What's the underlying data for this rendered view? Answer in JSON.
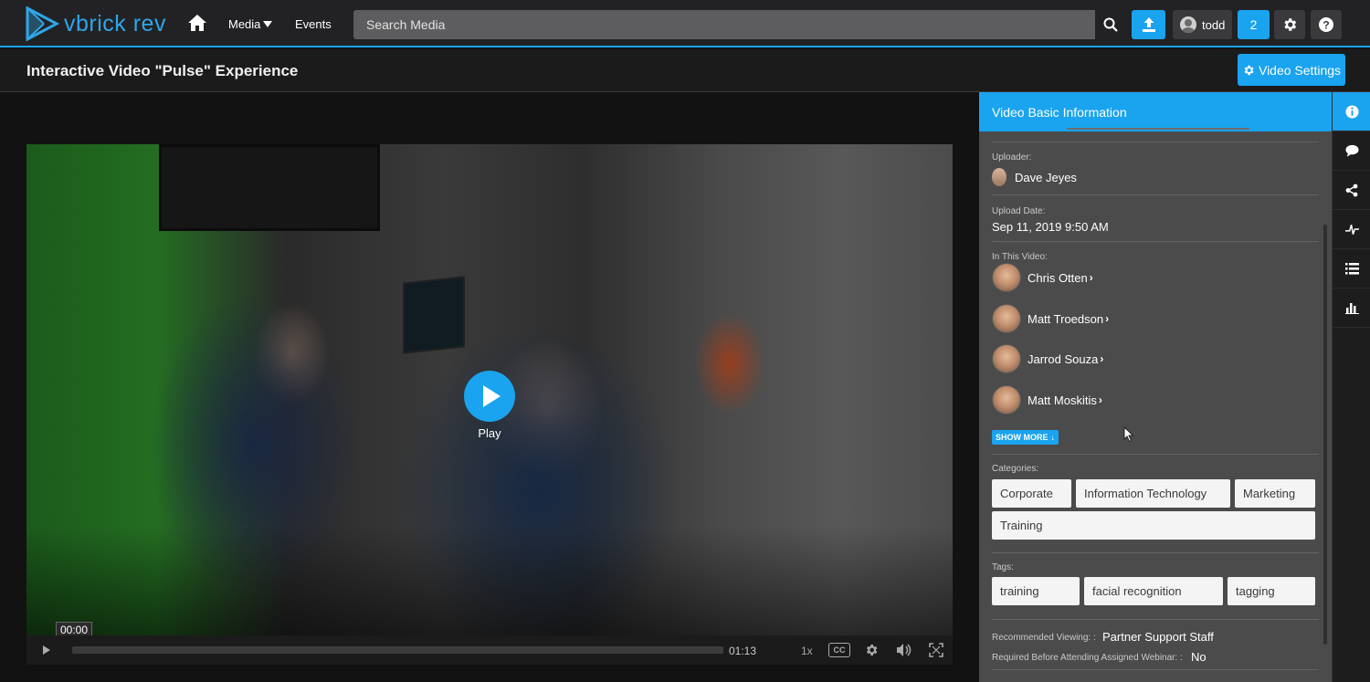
{
  "header": {
    "logo_text": "vbrick rev",
    "nav_media": "Media",
    "nav_events": "Events",
    "search_placeholder": "Search Media",
    "user_name": "todd",
    "notification_count": "2"
  },
  "title_bar": {
    "title": "Interactive Video \"Pulse\" Experience",
    "video_settings_label": "Video Settings"
  },
  "player": {
    "play_label": "Play",
    "current_time": "00:00",
    "duration": "01:13",
    "speed": "1x",
    "cc_label": "CC",
    "progress": 0
  },
  "panel": {
    "header": "Video Basic Information",
    "uploader_label": "Uploader:",
    "uploader_name": "Dave Jeyes",
    "upload_date_label": "Upload Date:",
    "upload_date": "Sep 11, 2019 9:50 AM",
    "in_video_label": "In This Video:",
    "people": [
      "Chris Otten",
      "Matt Troedson",
      "Jarrod Souza",
      "Matt Moskitis"
    ],
    "show_more": "SHOW MORE",
    "categories_label": "Categories:",
    "categories": [
      "Corporate",
      "Information Technology",
      "Marketing",
      "Training"
    ],
    "tags_label": "Tags:",
    "tags": [
      "training",
      "facial recognition",
      "tagging"
    ],
    "recommended_label": "Recommended Viewing: :",
    "recommended_value": "Partner Support Staff",
    "required_label": "Required Before Attending Assigned Webinar: :",
    "required_value": "No"
  },
  "rail_icons": [
    "info-icon",
    "comment-icon",
    "share-icon",
    "pulse-icon",
    "list-icon",
    "bar-chart-icon"
  ],
  "colors": {
    "accent": "#1aa3ef",
    "panel_bg": "#4b4b4c",
    "topbar_bg": "#222224"
  }
}
